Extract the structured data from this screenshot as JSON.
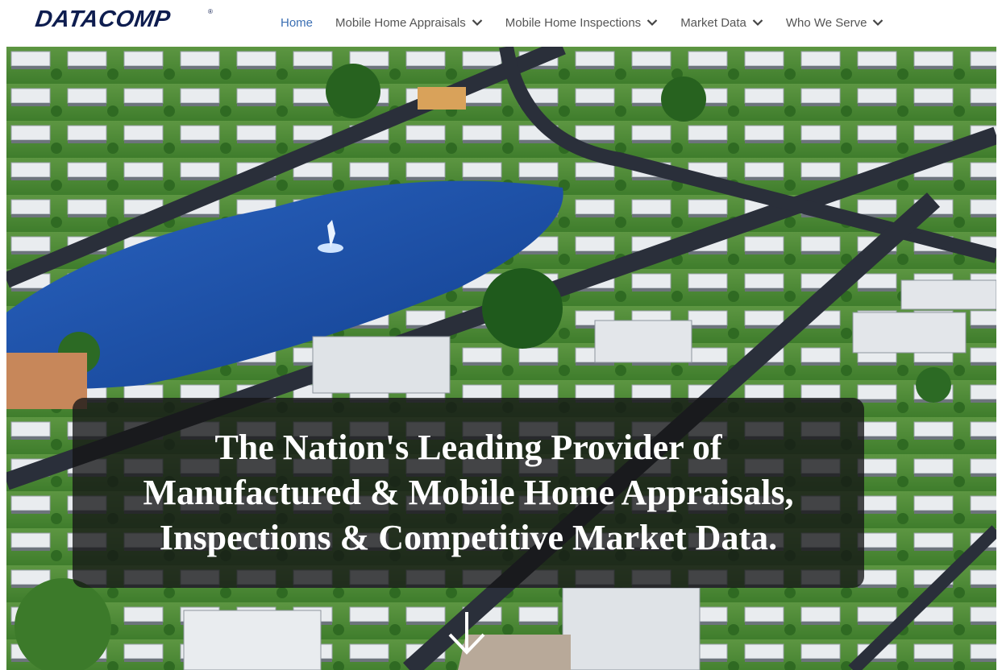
{
  "header": {
    "logo_text": "DATACOMP",
    "logo_mark": "®",
    "nav": [
      {
        "label": "Home",
        "active": true,
        "has_dropdown": false
      },
      {
        "label": "Mobile Home Appraisals",
        "active": false,
        "has_dropdown": true
      },
      {
        "label": "Mobile Home Inspections",
        "active": false,
        "has_dropdown": true
      },
      {
        "label": "Market Data",
        "active": false,
        "has_dropdown": true
      },
      {
        "label": "Who We Serve",
        "active": false,
        "has_dropdown": true
      }
    ]
  },
  "hero": {
    "headline_lines": [
      "The Nation's Leading Provider of",
      "Manufactured & Mobile Home Appraisals,",
      "Inspections & Competitive Market Data."
    ],
    "scroll_icon": "arrow-down-icon"
  },
  "colors": {
    "logo": "#0e1d4f",
    "nav_active": "#3b6fb3",
    "nav_text": "#555555",
    "banner_bg": "rgba(20,20,22,0.78)",
    "lake": "#1b4fa8",
    "grass": "#4f8a3a"
  }
}
